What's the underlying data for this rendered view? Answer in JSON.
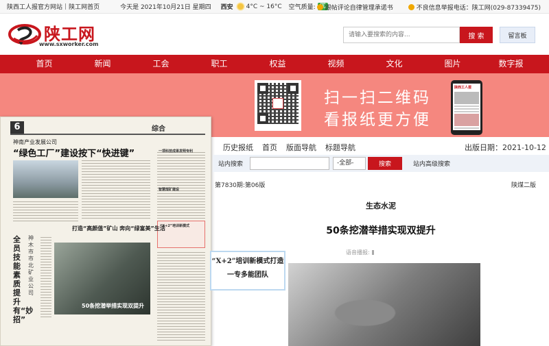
{
  "topbar": {
    "site": "陕西工人报官方网站",
    "sep": "|",
    "home": "陕工网首页",
    "date": "今天是 2021年10月21日 星期四",
    "city": "西安",
    "temp": "4°C ~ 16°C",
    "aq_label": "空气质量:",
    "aq_value": "优",
    "link1": "跟帖评论自律管理承诺书",
    "link2": "不良信息举报电话：陕工网(029-87339475)"
  },
  "header": {
    "logo_text": "陕工网",
    "logo_url": "www.sxworker.com",
    "search_placeholder": "请输入要搜索的内容...",
    "search_button": "搜 索",
    "guestbook": "留言板"
  },
  "nav": [
    "首页",
    "新闻",
    "工会",
    "职工",
    "权益",
    "视频",
    "文化",
    "图片",
    "数字报"
  ],
  "banner": {
    "line1": "扫一扫二维码",
    "line2": "看报纸更方便",
    "phone_title": "陕西工人报"
  },
  "paper": {
    "page_num": "6",
    "head": "综合",
    "company": "神南产业发展公司",
    "headline": "“绿色工厂”建设按下“快进键”",
    "sub1": "打造“高颜值”矿山 奔向“绿富美”生活",
    "sub2": "50条挖潜举措实现双提升",
    "vertical": "全员技能素质提升有“妙招”",
    "vertical2": "神木市市北矿业公司",
    "right1": "一项科技成果发明专利",
    "right2": "智慧煤矿建设",
    "right3": "“X+2”培训新模式"
  },
  "callout": "“X+2”培训新模式打造一专多能团队",
  "toolbar": {
    "tabs": [
      "历史报纸",
      "首页",
      "版面导航",
      "标题导航"
    ],
    "pub_date": "出版日期：2021-10-12"
  },
  "site_search": {
    "label": "站内搜索",
    "select": "-全部-",
    "button": "搜索",
    "advanced": "站内高级搜索"
  },
  "article": {
    "edition": "第7830期:第06版",
    "section": "陕煤二版",
    "kicker": "生态水泥",
    "title": "50条挖潜举措实现双提升",
    "read_aloud": "语音播报:"
  }
}
